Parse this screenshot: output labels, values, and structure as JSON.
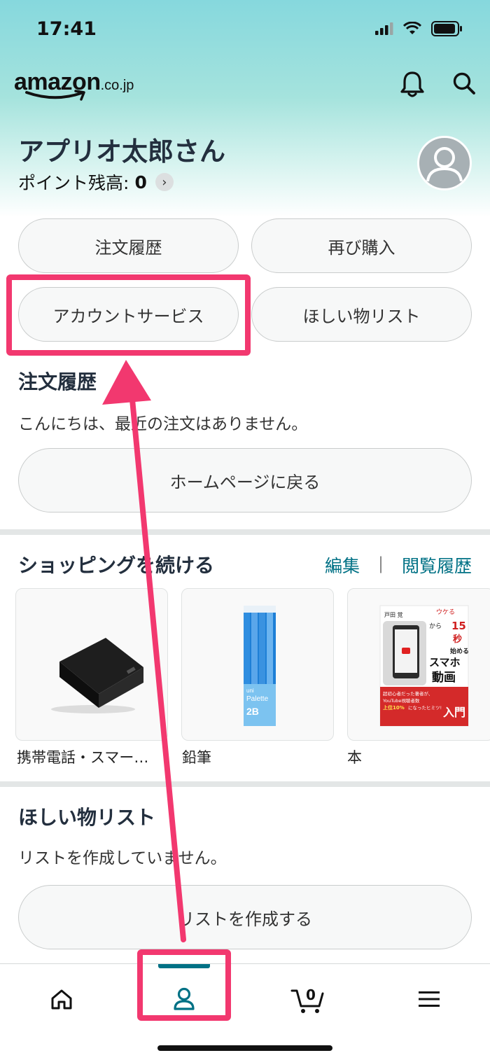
{
  "status": {
    "time": "17:41"
  },
  "logo": {
    "main": "amazon",
    "suffix": ".co.jp"
  },
  "profile": {
    "greeting": "アプリオ太郎さん",
    "points_label": "ポイント残高:",
    "points_value": "0"
  },
  "quick_buttons": {
    "orders": "注文履歴",
    "buy_again": "再び購入",
    "account_services": "アカウントサービス",
    "wishlist": "ほしい物リスト"
  },
  "orders_section": {
    "title": "注文履歴",
    "message": "こんにちは、最近の注文はありません。",
    "button": "ホームページに戻る"
  },
  "continue_shopping": {
    "title": "ショッピングを続ける",
    "edit_link": "編集",
    "separator": "|",
    "history_link": "閲覧履歴",
    "items": [
      {
        "label": "携帯電話・スマー…"
      },
      {
        "label": "鉛筆"
      },
      {
        "label": "本"
      }
    ]
  },
  "pencil_box": {
    "brand": "uni",
    "name": "Palette",
    "grade": "2B"
  },
  "book_cover": {
    "author": "戸田 覚",
    "tag": "ウケる",
    "title_number": "15",
    "title_unit": "秒",
    "title_from": "から",
    "title_start": "始める",
    "title_main1": "スマホ",
    "title_main2": "動画",
    "title_main3": "入門",
    "band_line1": "超初心者だった著者が、",
    "band_line2": "YouTube視聴者数",
    "band_line3": "上位10%",
    "band_line4": "になったヒミツ!"
  },
  "wishlist_section": {
    "title": "ほしい物リスト",
    "message": "リストを作成していません。",
    "button": "リストを作成する"
  },
  "tabbar": {
    "cart_count": "0",
    "active_tab": "account"
  },
  "colors": {
    "accent": "#007185",
    "highlight": "#f2386f",
    "header_top": "#86d8dd"
  }
}
